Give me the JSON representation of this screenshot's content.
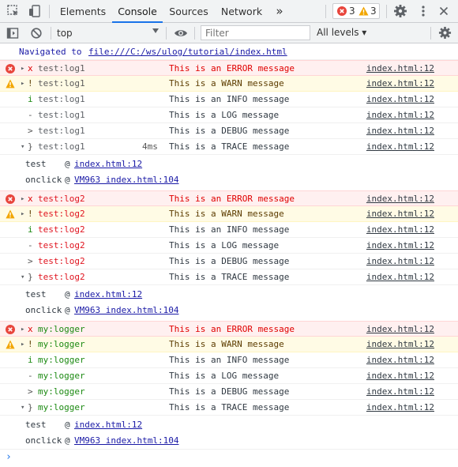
{
  "tabs": [
    {
      "label": "Elements"
    },
    {
      "label": "Console"
    },
    {
      "label": "Sources"
    },
    {
      "label": "Network"
    }
  ],
  "more_tabs": "»",
  "error_count": "3",
  "warning_count": "3",
  "toolbar": {
    "context": "top",
    "filter_placeholder": "Filter",
    "levels": "All levels ▾"
  },
  "navigation": {
    "text": "Navigated to",
    "url": "file:///C:/ws/ulog/tutorial/index.html"
  },
  "groups": [
    {
      "logger": "test:log1",
      "rows": [
        {
          "level": "error",
          "prefix": "x",
          "message": "This is an ERROR message",
          "source": "index.html:12"
        },
        {
          "level": "warn",
          "prefix": "!",
          "message": "This is a WARN message",
          "source": "index.html:12"
        },
        {
          "level": "info",
          "prefix": "i",
          "message": "This is an INFO message",
          "source": "index.html:12"
        },
        {
          "level": "log",
          "prefix": "-",
          "message": "This is a LOG message",
          "source": "index.html:12"
        },
        {
          "level": "debug",
          "prefix": ">",
          "message": "This is a DEBUG message",
          "source": "index.html:12"
        },
        {
          "level": "trace",
          "prefix": "}",
          "duration": "4ms",
          "message": "This is a TRACE message",
          "source": "index.html:12"
        }
      ],
      "stack": [
        {
          "fn": "test",
          "at": "@",
          "link": "index.html:12"
        },
        {
          "fn": "onclick",
          "at": "@",
          "link": "VM963 index.html:104"
        }
      ]
    },
    {
      "logger": "test:log2",
      "rows": [
        {
          "level": "error",
          "prefix": "x",
          "message": "This is an ERROR message",
          "source": "index.html:12"
        },
        {
          "level": "warn",
          "prefix": "!",
          "message": "This is a WARN message",
          "source": "index.html:12"
        },
        {
          "level": "info",
          "prefix": "i",
          "message": "This is an INFO message",
          "source": "index.html:12"
        },
        {
          "level": "log",
          "prefix": "-",
          "message": "This is a LOG message",
          "source": "index.html:12"
        },
        {
          "level": "debug",
          "prefix": ">",
          "message": "This is a DEBUG message",
          "source": "index.html:12"
        },
        {
          "level": "trace",
          "prefix": "}",
          "message": "This is a TRACE message",
          "source": "index.html:12"
        }
      ],
      "stack": [
        {
          "fn": "test",
          "at": "@",
          "link": "index.html:12"
        },
        {
          "fn": "onclick",
          "at": "@",
          "link": "VM963 index.html:104"
        }
      ]
    },
    {
      "logger": "my:logger",
      "rows": [
        {
          "level": "error",
          "prefix": "x",
          "message": "This is an ERROR message",
          "source": "index.html:12"
        },
        {
          "level": "warn",
          "prefix": "!",
          "message": "This is a WARN message",
          "source": "index.html:12"
        },
        {
          "level": "info",
          "prefix": "i",
          "message": "This is an INFO message",
          "source": "index.html:12"
        },
        {
          "level": "log",
          "prefix": "-",
          "message": "This is a LOG message",
          "source": "index.html:12"
        },
        {
          "level": "debug",
          "prefix": ">",
          "message": "This is a DEBUG message",
          "source": "index.html:12"
        },
        {
          "level": "trace",
          "prefix": "}",
          "message": "This is a TRACE message",
          "source": "index.html:12"
        }
      ],
      "stack": [
        {
          "fn": "test",
          "at": "@",
          "link": "index.html:12"
        },
        {
          "fn": "onclick",
          "at": "@",
          "link": "VM963 index.html:104"
        }
      ]
    }
  ],
  "prompt": "›",
  "colors": {
    "accent": "#1a73e8",
    "error": "#e00000",
    "warn_bg": "#fffbe5",
    "error_bg": "#fff0f0",
    "logger_gray": "#5f6368",
    "logger_red": "#e0141f",
    "logger_green": "#1c8a12"
  }
}
